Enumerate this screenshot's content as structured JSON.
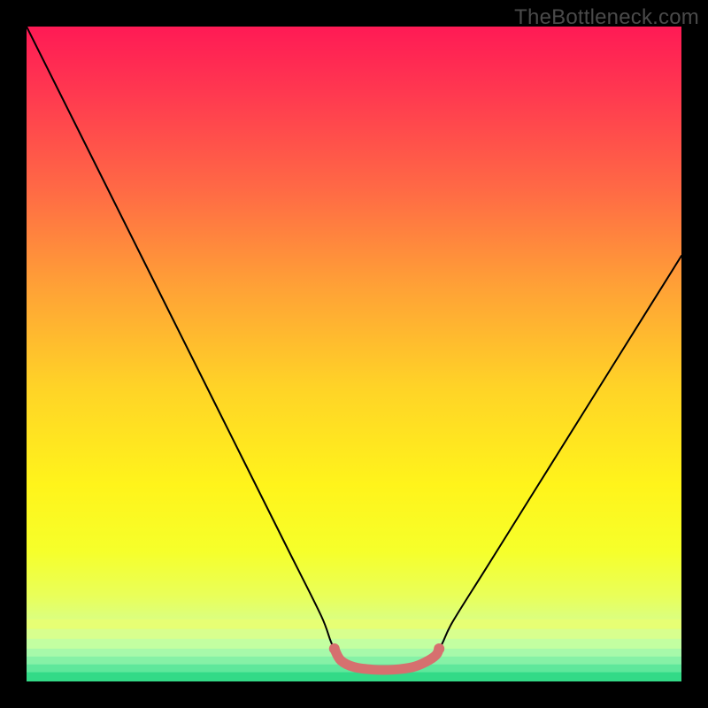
{
  "watermark": "TheBottleneck.com",
  "chart_data": {
    "type": "line",
    "title": "",
    "xlabel": "",
    "ylabel": "",
    "xlim": [
      0,
      100
    ],
    "ylim": [
      0,
      100
    ],
    "grid": false,
    "legend": false,
    "annotations": [],
    "series": [
      {
        "name": "curve",
        "x": [
          0,
          5,
          10,
          15,
          20,
          25,
          30,
          35,
          40,
          45,
          47,
          50,
          55,
          60,
          63,
          65,
          70,
          75,
          80,
          85,
          90,
          95,
          100
        ],
        "y": [
          100,
          90,
          80,
          70,
          60,
          50,
          40,
          30,
          20,
          10,
          5,
          2,
          2,
          2,
          5,
          9,
          17,
          25,
          33,
          41,
          49,
          57,
          65
        ],
        "color": "#000000"
      },
      {
        "name": "bottom-highlight",
        "x": [
          47,
          48,
          50,
          53,
          56,
          59,
          61,
          62.5,
          63
        ],
        "y": [
          5,
          3.2,
          2.2,
          1.8,
          1.8,
          2.2,
          3,
          4,
          5
        ],
        "color": "#d6706f",
        "thick": true
      }
    ],
    "background_gradient": {
      "stops": [
        {
          "offset": 0.0,
          "color": "#ff1a55"
        },
        {
          "offset": 0.1,
          "color": "#ff3850"
        },
        {
          "offset": 0.25,
          "color": "#ff6a45"
        },
        {
          "offset": 0.4,
          "color": "#ffa236"
        },
        {
          "offset": 0.55,
          "color": "#ffd327"
        },
        {
          "offset": 0.7,
          "color": "#fff41b"
        },
        {
          "offset": 0.8,
          "color": "#f6ff2a"
        },
        {
          "offset": 0.87,
          "color": "#e9ff5a"
        },
        {
          "offset": 0.915,
          "color": "#d7ff8a"
        },
        {
          "offset": 0.945,
          "color": "#b8ffad"
        },
        {
          "offset": 0.965,
          "color": "#8cf7b4"
        },
        {
          "offset": 0.985,
          "color": "#4fe79a"
        },
        {
          "offset": 1.0,
          "color": "#2ad880"
        }
      ]
    }
  }
}
